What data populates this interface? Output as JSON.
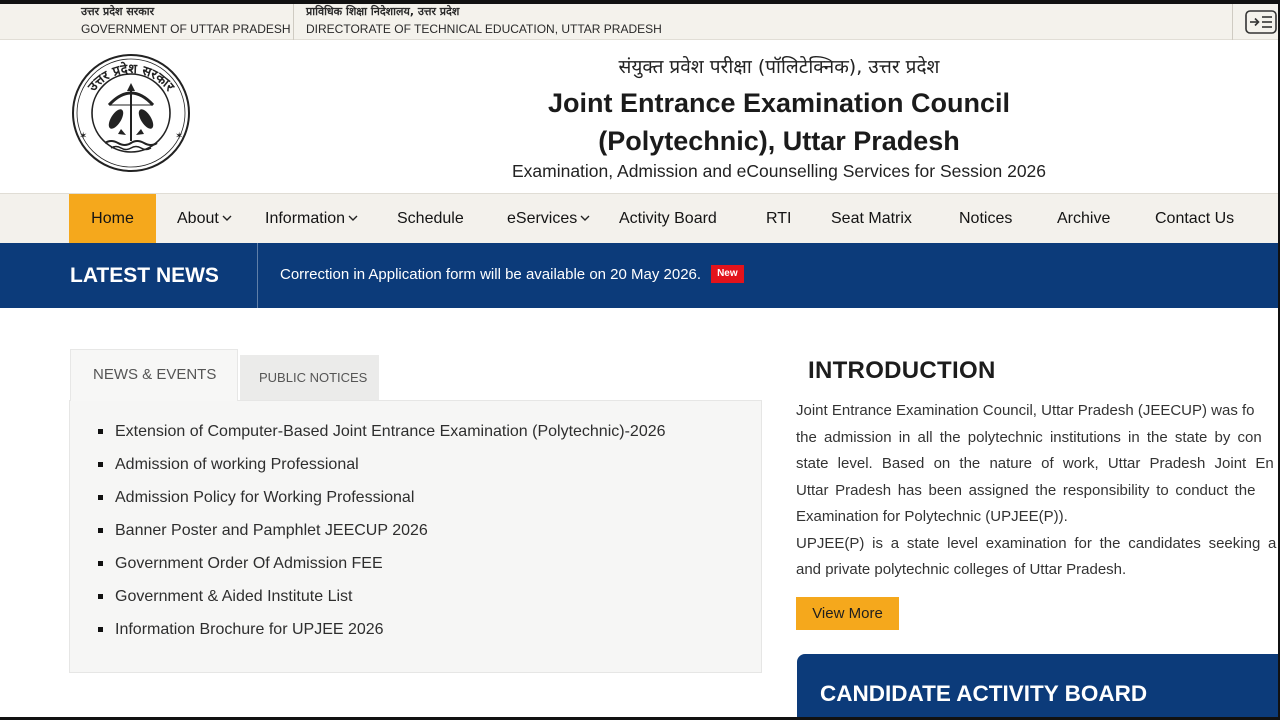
{
  "topbar": {
    "gov_hindi": "उत्तर प्रदेश सरकार",
    "gov_english": "GOVERNMENT OF UTTAR PRADESH",
    "dept_hindi": "प्राविधिक शिक्षा निदेशालय, उत्तर प्रदेश",
    "dept_english": "DIRECTORATE OF TECHNICAL EDUCATION, UTTAR PRADESH",
    "menu_icon": "menu-toggle-icon"
  },
  "emblem": {
    "text": "उत्तर प्रदेश सरकार",
    "icon": "uttar-pradesh-seal"
  },
  "header": {
    "hindi_title": "संयुक्त प्रवेश परीक्षा (पॉलिटेक्निक), उत्तर प्रदेश",
    "title_line1": "Joint Entrance Examination Council",
    "title_line2": "(Polytechnic), Uttar Pradesh",
    "subtitle": "Examination, Admission and eCounselling Services for Session 2026"
  },
  "nav": {
    "items": [
      {
        "label": "Home",
        "active": true
      },
      {
        "label": "About",
        "dropdown": true
      },
      {
        "label": "Information",
        "dropdown": true
      },
      {
        "label": "Schedule"
      },
      {
        "label": "eServices",
        "dropdown": true
      },
      {
        "label": "Activity Board"
      },
      {
        "label": "RTI"
      },
      {
        "label": "Seat Matrix"
      },
      {
        "label": "Notices"
      },
      {
        "label": "Archive"
      },
      {
        "label": "Contact Us"
      }
    ]
  },
  "news_ticker": {
    "heading": "LATEST NEWS",
    "text": "Correction in Application form will be available on 20 May 2026.",
    "badge": "New"
  },
  "tabs": [
    {
      "label": "NEWS & EVENTS",
      "active": true
    },
    {
      "label": "PUBLIC NOTICES",
      "active": false
    }
  ],
  "news_events": [
    "Extension of Computer-Based Joint Entrance Examination (Polytechnic)-2026",
    "Admission of working Professional",
    "Admission Policy for Working Professional",
    "Banner Poster and Pamphlet JEECUP 2026",
    "Government Order Of Admission FEE",
    "Government & Aided Institute List",
    "Information Brochure for UPJEE 2026"
  ],
  "intro": {
    "heading": "INTRODUCTION",
    "lines": [
      "Joint Entrance Examination Council, Uttar Pradesh (JEECUP) was fo",
      "the admission in all the polytechnic institutions in the state by con",
      "state level. Based on the nature of work, Uttar Pradesh Joint En",
      "Uttar Pradesh has been assigned the responsibility to conduct the",
      "Examination for Polytechnic (UPJEE(P)).",
      "UPJEE(P) is a state level examination for the candidates seeking a",
      "and private polytechnic colleges of Uttar Pradesh."
    ],
    "button": "View More"
  },
  "activity_board": {
    "heading": "CANDIDATE ACTIVITY BOARD"
  },
  "colors": {
    "accent": "#f5a81c",
    "primary": "#0c3b7a",
    "badge": "#e3131b",
    "topbar": "#f4f2ec"
  }
}
